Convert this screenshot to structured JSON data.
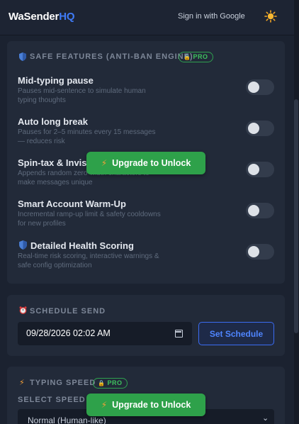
{
  "header": {
    "logo_main": "WaSender",
    "logo_accent": "HQ",
    "signin_label": "Sign in with Google",
    "theme_icon": "sun-icon"
  },
  "safe_features": {
    "title": "SAFE FEATURES (ANTI-BAN ENGINE)",
    "badge": "PRO",
    "items": [
      {
        "title": "Mid-typing pause",
        "desc": "Pauses mid-sentence to simulate human typing thoughts",
        "enabled": false
      },
      {
        "title": "Auto long break",
        "desc": "Pauses for 2–5 minutes every 15 messages — reduces risk",
        "enabled": false
      },
      {
        "title": "Spin-tax & Invisib",
        "desc": "Appends random zero-width characters to make messages unique",
        "enabled": false
      },
      {
        "title": "Smart Account Warm-Up",
        "desc": "Incremental ramp-up limit & safety cooldowns for new profiles",
        "enabled": false
      },
      {
        "title": "Detailed Health Scoring",
        "desc": "Real-time risk scoring, interactive warnings & safe config optimization",
        "enabled": false
      }
    ],
    "upgrade_label": "Upgrade to Unlock"
  },
  "schedule": {
    "title": "SCHEDULE SEND",
    "datetime_value": "09/28/2026 02:02 AM",
    "button_label": "Set Schedule"
  },
  "typing_speed": {
    "title": "TYPING SPEED",
    "badge": "PRO",
    "select_label": "SELECT SPEED",
    "select_value": "Normal (Human-like)",
    "upgrade_label": "Upgrade to Unlock"
  },
  "colors": {
    "accent_blue": "#3f7bf7",
    "pro_green": "#2ea14a",
    "background": "#1b2230",
    "card": "#222a39"
  }
}
